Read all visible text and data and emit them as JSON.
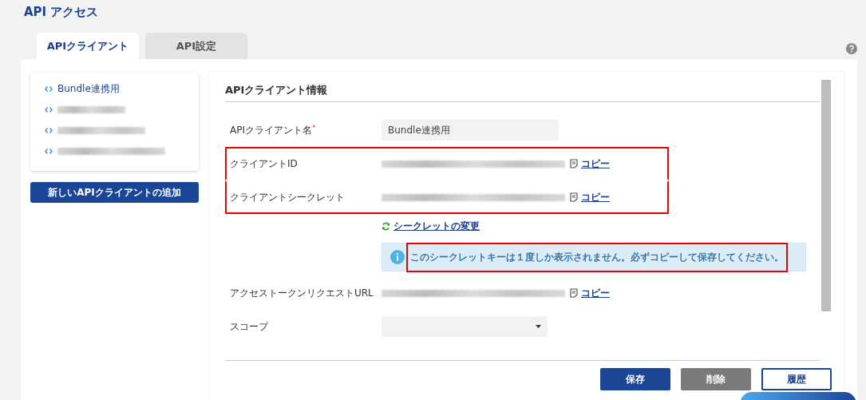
{
  "page_title": "API アクセス",
  "tabs": [
    {
      "label": "APIクライアント",
      "selected": true
    },
    {
      "label": "API設定",
      "selected": false
    }
  ],
  "clients": [
    {
      "name": "Bundle連携用",
      "selected": true,
      "redacted": false
    },
    {
      "selected": false,
      "redacted": true
    },
    {
      "selected": false,
      "redacted": true
    },
    {
      "selected": false,
      "redacted": true
    }
  ],
  "add_button": "新しいAPIクライアントの追加",
  "section_title": "APIクライアント情報",
  "fields": [
    {
      "kind": "input",
      "label": "APIクライアント名",
      "required_mark": "*",
      "value": "Bundle連携用",
      "highlighted": false
    },
    {
      "kind": "secret",
      "label": "クライアントID",
      "copy": "コピー",
      "highlighted": true
    },
    {
      "kind": "secret",
      "label": "クライアントシークレット",
      "copy": "コピー",
      "highlighted": true
    },
    {
      "kind": "action",
      "link": "シークレットの変更",
      "highlighted": false
    },
    {
      "kind": "notice",
      "text": "このシークレットキーは１度しか表示されません。必ずコピーして保存してください。",
      "highlighted": true
    },
    {
      "kind": "secret",
      "label": "アクセストークンリクエストURL",
      "copy": "コピー",
      "highlighted": false
    },
    {
      "kind": "select",
      "label": "スコープ",
      "highlighted": false
    }
  ],
  "buttons": [
    {
      "label": "保存",
      "kind": "primary"
    },
    {
      "label": "削除",
      "kind": "secondary"
    },
    {
      "label": "履歴",
      "kind": "outline"
    }
  ]
}
